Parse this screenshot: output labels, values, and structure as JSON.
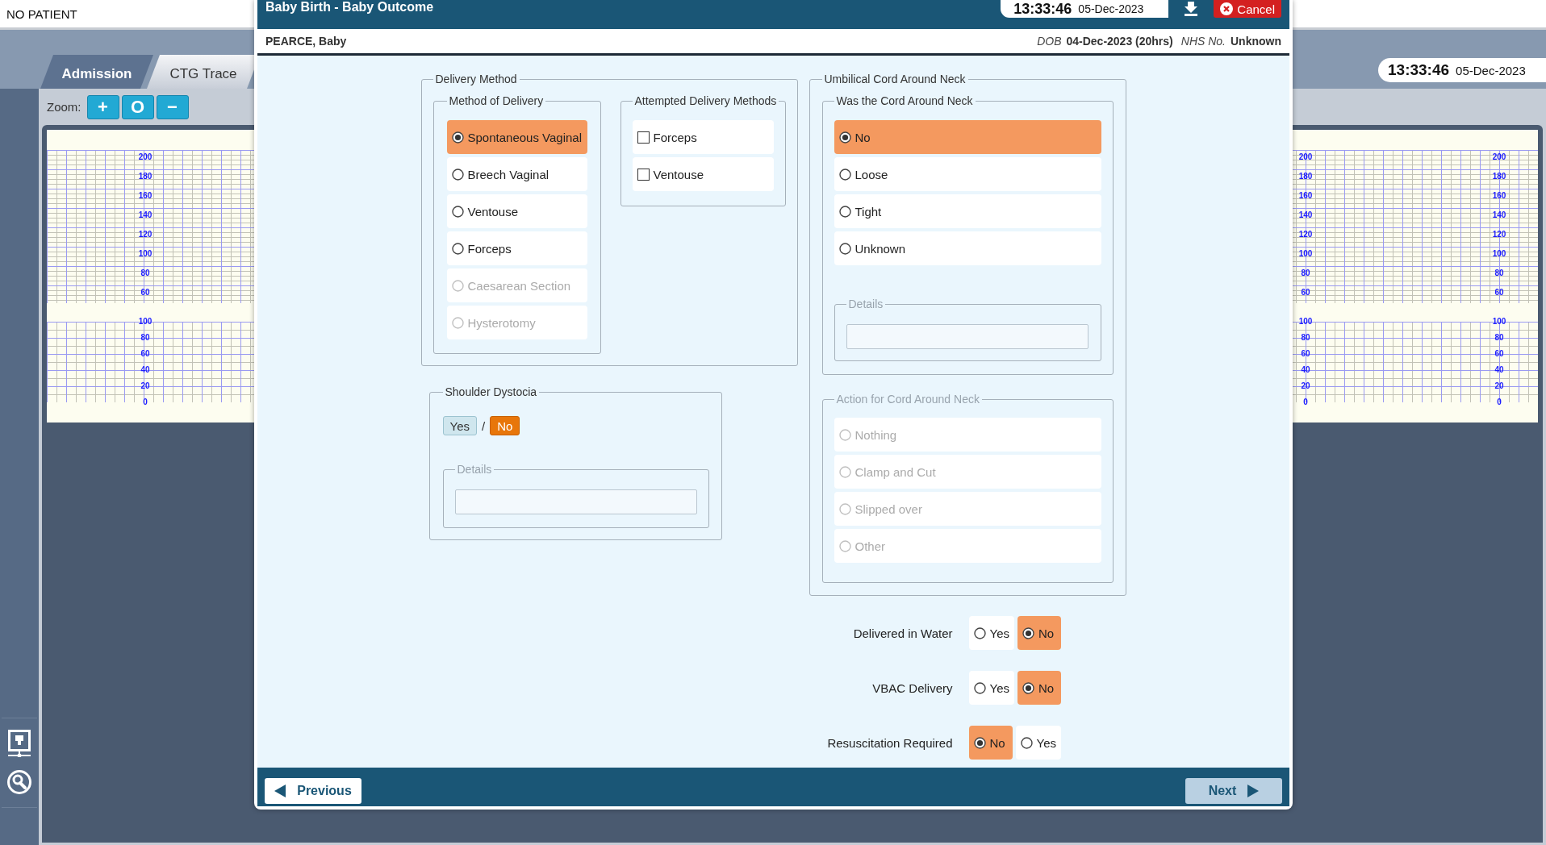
{
  "top_bar": {
    "patient": "NO PATIENT"
  },
  "tabs": [
    {
      "label": "Admission",
      "selected": false
    },
    {
      "label": "CTG Trace",
      "selected": true
    }
  ],
  "clock": {
    "time": "13:33:46",
    "date": "05-Dec-2023"
  },
  "zoom": {
    "label": "Zoom:",
    "buttons": [
      "+",
      "O",
      "−"
    ]
  },
  "ctg": {
    "scales": [
      {
        "fhr": [
          "200",
          "180",
          "160",
          "140",
          "120",
          "100",
          "80",
          "60"
        ],
        "toco": [
          "100",
          "80",
          "60",
          "40",
          "20",
          "0"
        ]
      },
      {
        "fhr": [
          "200",
          "180",
          "160",
          "140",
          "120",
          "100",
          "80",
          "60"
        ],
        "toco": [
          "100",
          "80",
          "60",
          "40",
          "20",
          "0"
        ]
      },
      {
        "fhr": [
          "200",
          "180",
          "160",
          "140",
          "120",
          "100",
          "80",
          "60"
        ],
        "toco": [
          "100",
          "80",
          "60",
          "40",
          "20",
          "0"
        ]
      }
    ]
  },
  "dialog": {
    "title": "Baby Birth - Baby Outcome",
    "clock": {
      "time": "13:33:46",
      "date": "05-Dec-2023"
    },
    "cancel": "Cancel",
    "patient": {
      "name": "PEARCE, Baby",
      "dob_label": "DOB",
      "dob": "04-Dec-2023 (20hrs)",
      "nhs_label": "NHS No.",
      "nhs": "Unknown"
    },
    "delivery_method": {
      "legend": "Delivery Method",
      "method": {
        "legend": "Method of Delivery",
        "options": [
          {
            "label": "Spontaneous Vaginal",
            "selected": true,
            "disabled": false
          },
          {
            "label": "Breech Vaginal",
            "selected": false,
            "disabled": false
          },
          {
            "label": "Ventouse",
            "selected": false,
            "disabled": false
          },
          {
            "label": "Forceps",
            "selected": false,
            "disabled": false
          },
          {
            "label": "Caesarean Section",
            "selected": false,
            "disabled": true
          },
          {
            "label": "Hysterotomy",
            "selected": false,
            "disabled": true
          }
        ]
      },
      "attempted": {
        "legend": "Attempted Delivery Methods",
        "options": [
          {
            "label": "Forceps",
            "checked": false
          },
          {
            "label": "Ventouse",
            "checked": false
          }
        ]
      }
    },
    "shoulder_dystocia": {
      "legend": "Shoulder Dystocia",
      "separator": "/",
      "toggle": [
        {
          "label": "Yes",
          "selected": false
        },
        {
          "label": "No",
          "selected": true
        }
      ],
      "details": {
        "legend": "Details",
        "disabled": true
      }
    },
    "cord": {
      "legend": "Umbilical Cord Around Neck",
      "was": {
        "legend": "Was the Cord Around Neck",
        "options": [
          {
            "label": "No",
            "selected": true,
            "disabled": false
          },
          {
            "label": "Loose",
            "selected": false,
            "disabled": false
          },
          {
            "label": "Tight",
            "selected": false,
            "disabled": false
          },
          {
            "label": "Unknown",
            "selected": false,
            "disabled": false
          }
        ],
        "details": {
          "legend": "Details",
          "disabled": true
        }
      },
      "action": {
        "legend": "Action for Cord Around Neck",
        "disabled": true,
        "options": [
          {
            "label": "Nothing",
            "selected": false,
            "disabled": true
          },
          {
            "label": "Clamp and Cut",
            "selected": false,
            "disabled": true
          },
          {
            "label": "Slipped over",
            "selected": false,
            "disabled": true
          },
          {
            "label": "Other",
            "selected": false,
            "disabled": true
          }
        ]
      }
    },
    "questions": [
      {
        "label": "Delivered in Water",
        "options": [
          {
            "label": "Yes",
            "selected": false
          },
          {
            "label": "No",
            "selected": true
          }
        ]
      },
      {
        "label": "VBAC Delivery",
        "options": [
          {
            "label": "Yes",
            "selected": false
          },
          {
            "label": "No",
            "selected": true
          }
        ]
      },
      {
        "label": "Resuscitation Required",
        "options": [
          {
            "label": "No",
            "selected": true
          },
          {
            "label": "Yes",
            "selected": false
          }
        ]
      }
    ],
    "footer": {
      "previous": "Previous",
      "next": "Next"
    }
  }
}
